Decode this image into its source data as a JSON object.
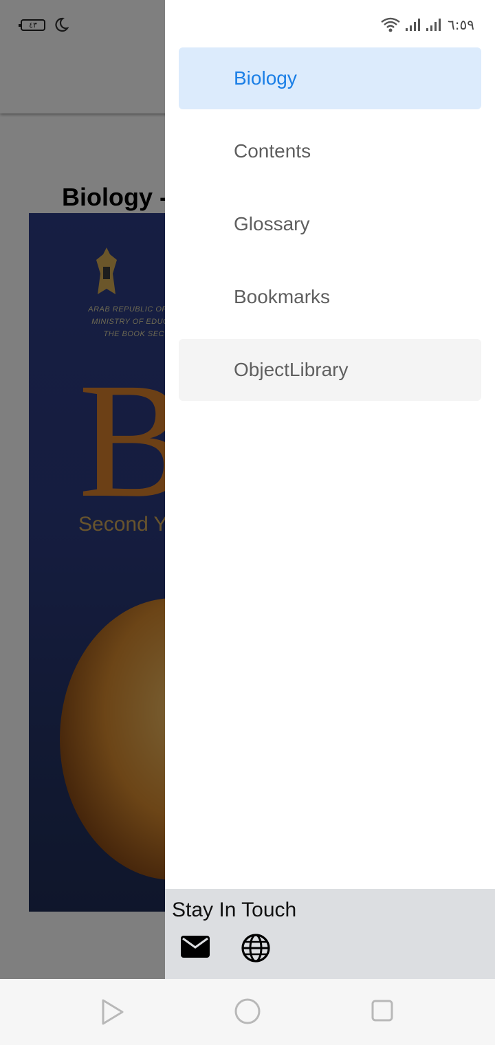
{
  "status_bar": {
    "battery": "٤٣",
    "time": "٦:٥٩",
    "icons": [
      "moon-icon",
      "wifi-icon",
      "signal-icon",
      "signal-icon"
    ]
  },
  "page": {
    "title": "Biology - ",
    "cover": {
      "ministry_lines": [
        "ARAB REPUBLIC OF EGYPT",
        "MINISTRY OF EDUCATION",
        "THE BOOK SECTOR"
      ],
      "big_title": "Bio",
      "subtitle": "Second Year"
    }
  },
  "drawer": {
    "items": [
      {
        "label": "Biology",
        "state": "selected"
      },
      {
        "label": "Contents",
        "state": "normal"
      },
      {
        "label": "Glossary",
        "state": "normal"
      },
      {
        "label": "Bookmarks",
        "state": "normal"
      },
      {
        "label": "ObjectLibrary",
        "state": "hovered"
      }
    ],
    "footer": {
      "title": "Stay In Touch",
      "icons": [
        "mail-icon",
        "globe-icon"
      ]
    }
  },
  "nav_bar": {
    "icons": [
      "back-triangle-icon",
      "home-circle-icon",
      "recents-square-icon"
    ]
  },
  "colors": {
    "accent": "#1b7fe6",
    "selected_bg": "#dcebfc",
    "footer_bg": "#dcdee1"
  }
}
